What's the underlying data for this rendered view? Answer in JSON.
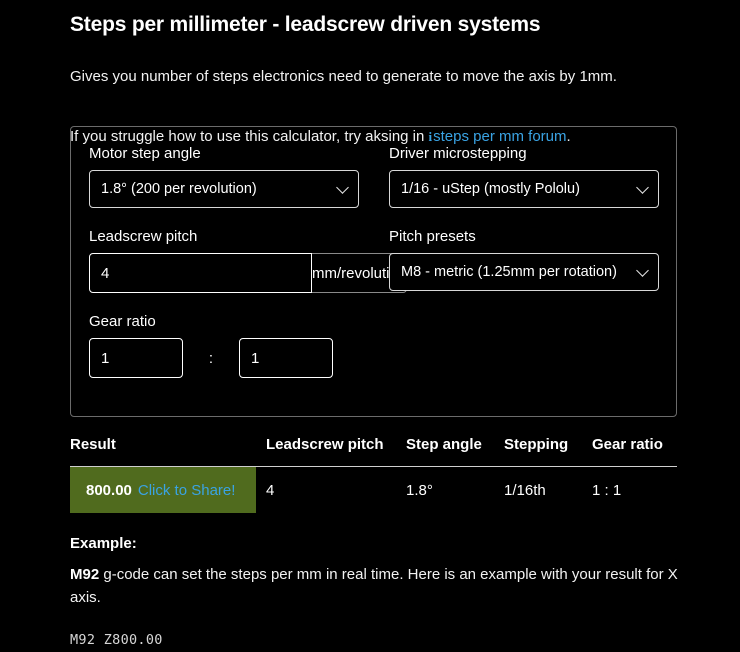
{
  "header": {
    "title": "Steps per millimeter - leadscrew driven systems",
    "description": "Gives you number of steps electronics need to generate to move the axis by 1mm.",
    "help_prefix": "If you struggle how to use this calculator, try aksing in ",
    "help_icon": "i",
    "help_link": "steps per mm forum",
    "help_suffix": "."
  },
  "form": {
    "motor_step_angle": {
      "label": "Motor step angle",
      "value": "1.8° (200 per revolution)"
    },
    "driver_microstepping": {
      "label": "Driver microstepping",
      "value": "1/16 - uStep (mostly Pololu)"
    },
    "leadscrew_pitch": {
      "label": "Leadscrew pitch",
      "value": "4",
      "placeholder": "",
      "unit": "mm/revolution"
    },
    "pitch_presets": {
      "label": "Pitch presets",
      "value": "M8 - metric (1.25mm per rotation)"
    },
    "gear_ratio": {
      "label": "Gear ratio",
      "numerator": "1",
      "separator": ":",
      "denominator": "1"
    }
  },
  "table": {
    "headers": {
      "result": "Result",
      "pitch": "Leadscrew pitch",
      "angle": "Step angle",
      "stepping": "Stepping",
      "gear": "Gear ratio"
    },
    "row": {
      "result_value": "800.00",
      "result_share": "Click to Share!",
      "pitch": "4",
      "angle": "1.8°",
      "stepping": "1/16th",
      "gear": "1 : 1"
    }
  },
  "example": {
    "title": "Example:",
    "gcode_name": "M92",
    "text": " g-code can set the steps per mm in real time. Here is an example with your result for X axis.",
    "code": "M92 Z800.00"
  },
  "colors": {
    "background": "#000000",
    "accent_link": "#3aa3e3",
    "result_green": "#506b1e",
    "border_panel": "#6b6b6b"
  }
}
